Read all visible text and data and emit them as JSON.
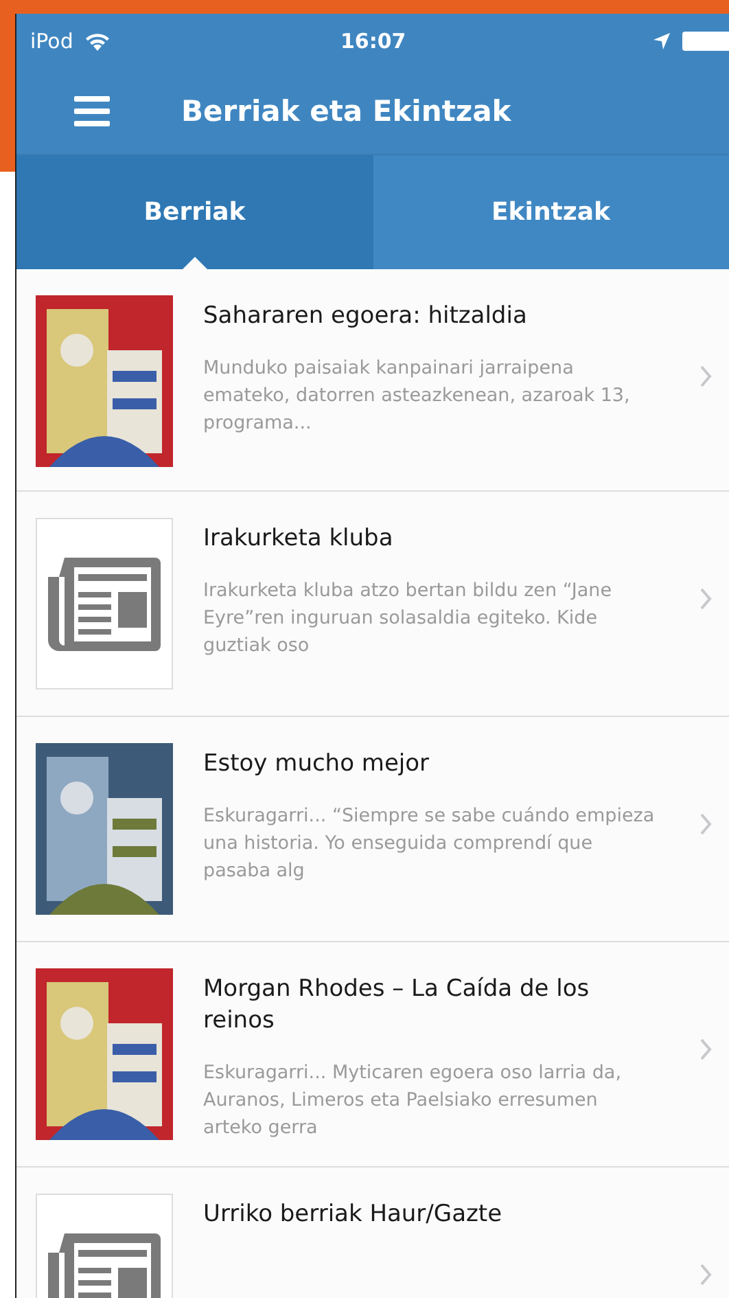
{
  "status_bar": {
    "carrier": "iPod",
    "time": "16:07"
  },
  "nav_bar": {
    "title": "Berriak eta Ekintzak"
  },
  "tabs": [
    {
      "label": "Berriak",
      "selected": true
    },
    {
      "label": "Ekintzak",
      "selected": false
    }
  ],
  "items": [
    {
      "title": "Sahararen egoera: hitzaldia",
      "summary": "Munduko paisaiak kanpainari jarraipena emateko, datorren asteazkenean, azaroak 13, programa..."
    },
    {
      "title": "Irakurketa kluba",
      "summary": " Irakurketa kluba atzo bertan bildu zen “Jane Eyre”ren inguruan solasaldia egiteko. Kide guztiak oso",
      "thumbnail": {
        "kind": "placeholder"
      }
    },
    {
      "title": "Estoy mucho mejor",
      "summary": "Eskuragarri...     “Siempre se sabe cuándo empieza una historia. Yo enseguida comprendí que pasaba alg"
    },
    {
      "title": "Morgan Rhodes – La Caída de los reinos",
      "summary": "Eskuragarri...  Myticaren egoera oso larria da, Auranos, Limeros eta Paelsiako erresumen arteko gerra"
    },
    {
      "title": "Urriko berriak Haur/Gazte",
      "thumbnail": {
        "kind": "placeholder"
      }
    }
  ]
}
